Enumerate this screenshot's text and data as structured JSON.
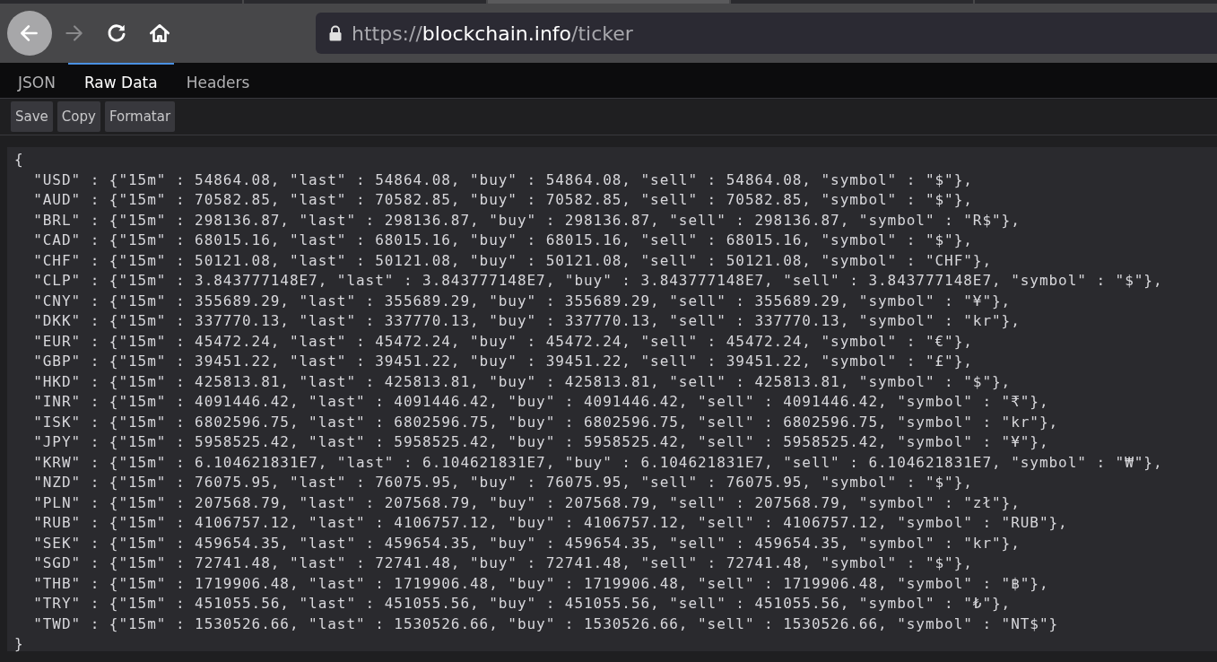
{
  "toolbar": {
    "nav_buttons": [
      {
        "kind": "back",
        "disabled": false
      },
      {
        "kind": "forward",
        "disabled": true
      },
      {
        "kind": "reload",
        "disabled": false
      },
      {
        "kind": "home",
        "disabled": false
      }
    ],
    "address": {
      "scheme": "https://",
      "host": "blockchain.info",
      "path": "/ticker"
    }
  },
  "tabs": [
    {
      "label": "JSON",
      "selected": false
    },
    {
      "label": "Raw Data",
      "selected": true
    },
    {
      "label": "Headers",
      "selected": false
    }
  ],
  "buttons": [
    "Save",
    "Copy",
    "Formatar"
  ],
  "raw_data": {
    "lines": [
      "{",
      "  \"USD\" : {\"15m\" : 54864.08, \"last\" : 54864.08, \"buy\" : 54864.08, \"sell\" : 54864.08, \"symbol\" : \"$\"},",
      "  \"AUD\" : {\"15m\" : 70582.85, \"last\" : 70582.85, \"buy\" : 70582.85, \"sell\" : 70582.85, \"symbol\" : \"$\"},",
      "  \"BRL\" : {\"15m\" : 298136.87, \"last\" : 298136.87, \"buy\" : 298136.87, \"sell\" : 298136.87, \"symbol\" : \"R$\"},",
      "  \"CAD\" : {\"15m\" : 68015.16, \"last\" : 68015.16, \"buy\" : 68015.16, \"sell\" : 68015.16, \"symbol\" : \"$\"},",
      "  \"CHF\" : {\"15m\" : 50121.08, \"last\" : 50121.08, \"buy\" : 50121.08, \"sell\" : 50121.08, \"symbol\" : \"CHF\"},",
      "  \"CLP\" : {\"15m\" : 3.843777148E7, \"last\" : 3.843777148E7, \"buy\" : 3.843777148E7, \"sell\" : 3.843777148E7, \"symbol\" : \"$\"},",
      "  \"CNY\" : {\"15m\" : 355689.29, \"last\" : 355689.29, \"buy\" : 355689.29, \"sell\" : 355689.29, \"symbol\" : \"¥\"},",
      "  \"DKK\" : {\"15m\" : 337770.13, \"last\" : 337770.13, \"buy\" : 337770.13, \"sell\" : 337770.13, \"symbol\" : \"kr\"},",
      "  \"EUR\" : {\"15m\" : 45472.24, \"last\" : 45472.24, \"buy\" : 45472.24, \"sell\" : 45472.24, \"symbol\" : \"€\"},",
      "  \"GBP\" : {\"15m\" : 39451.22, \"last\" : 39451.22, \"buy\" : 39451.22, \"sell\" : 39451.22, \"symbol\" : \"£\"},",
      "  \"HKD\" : {\"15m\" : 425813.81, \"last\" : 425813.81, \"buy\" : 425813.81, \"sell\" : 425813.81, \"symbol\" : \"$\"},",
      "  \"INR\" : {\"15m\" : 4091446.42, \"last\" : 4091446.42, \"buy\" : 4091446.42, \"sell\" : 4091446.42, \"symbol\" : \"₹\"},",
      "  \"ISK\" : {\"15m\" : 6802596.75, \"last\" : 6802596.75, \"buy\" : 6802596.75, \"sell\" : 6802596.75, \"symbol\" : \"kr\"},",
      "  \"JPY\" : {\"15m\" : 5958525.42, \"last\" : 5958525.42, \"buy\" : 5958525.42, \"sell\" : 5958525.42, \"symbol\" : \"¥\"},",
      "  \"KRW\" : {\"15m\" : 6.104621831E7, \"last\" : 6.104621831E7, \"buy\" : 6.104621831E7, \"sell\" : 6.104621831E7, \"symbol\" : \"₩\"},",
      "  \"NZD\" : {\"15m\" : 76075.95, \"last\" : 76075.95, \"buy\" : 76075.95, \"sell\" : 76075.95, \"symbol\" : \"$\"},",
      "  \"PLN\" : {\"15m\" : 207568.79, \"last\" : 207568.79, \"buy\" : 207568.79, \"sell\" : 207568.79, \"symbol\" : \"zł\"},",
      "  \"RUB\" : {\"15m\" : 4106757.12, \"last\" : 4106757.12, \"buy\" : 4106757.12, \"sell\" : 4106757.12, \"symbol\" : \"RUB\"},",
      "  \"SEK\" : {\"15m\" : 459654.35, \"last\" : 459654.35, \"buy\" : 459654.35, \"sell\" : 459654.35, \"symbol\" : \"kr\"},",
      "  \"SGD\" : {\"15m\" : 72741.48, \"last\" : 72741.48, \"buy\" : 72741.48, \"sell\" : 72741.48, \"symbol\" : \"$\"},",
      "  \"THB\" : {\"15m\" : 1719906.48, \"last\" : 1719906.48, \"buy\" : 1719906.48, \"sell\" : 1719906.48, \"symbol\" : \"฿\"},",
      "  \"TRY\" : {\"15m\" : 451055.56, \"last\" : 451055.56, \"buy\" : 451055.56, \"sell\" : 451055.56, \"symbol\" : \"₺\"},",
      "  \"TWD\" : {\"15m\" : 1530526.66, \"last\" : 1530526.66, \"buy\" : 1530526.66, \"sell\" : 1530526.66, \"symbol\" : \"NT$\"}",
      "}"
    ]
  }
}
